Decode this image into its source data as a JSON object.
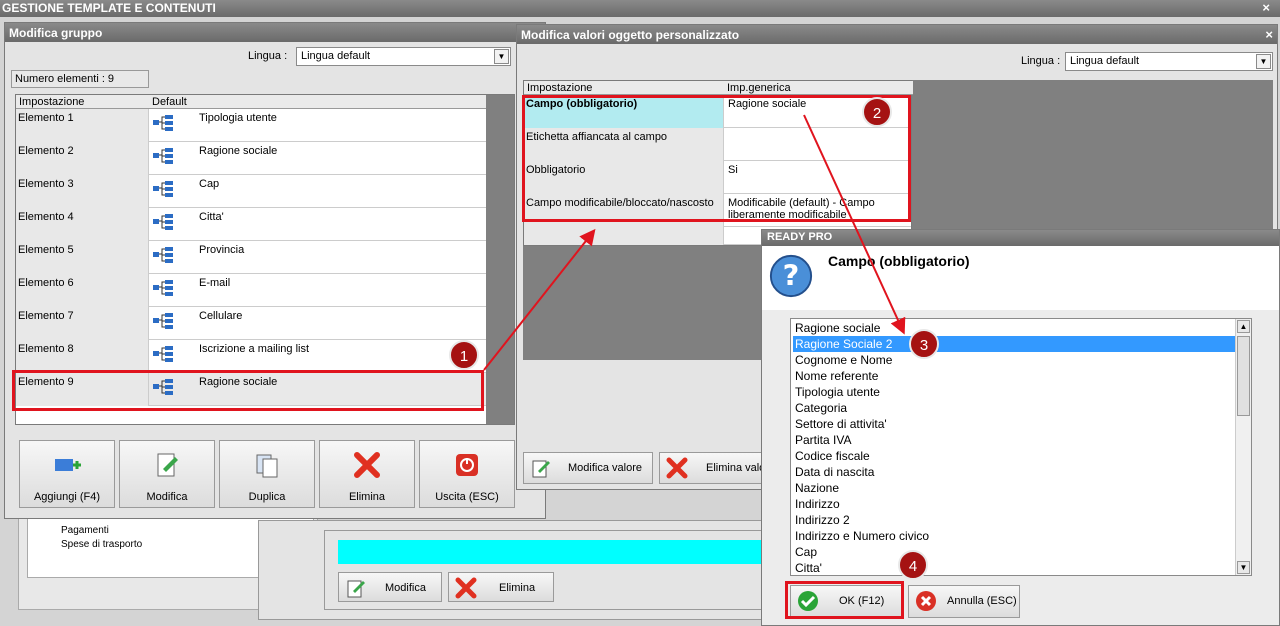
{
  "main_title": "GESTIONE TEMPLATE E CONTENUTI",
  "group_window": {
    "title": "Modifica gruppo",
    "lingua_label": "Lingua :",
    "lingua_value": "Lingua default",
    "count_label": "Numero elementi : 9",
    "columns": [
      "Impostazione",
      "Default"
    ],
    "rows": [
      {
        "name": "Elemento 1",
        "value": "Tipologia utente"
      },
      {
        "name": "Elemento 2",
        "value": "Ragione sociale"
      },
      {
        "name": "Elemento 3",
        "value": "Cap"
      },
      {
        "name": "Elemento 4",
        "value": "Citta'"
      },
      {
        "name": "Elemento 5",
        "value": "Provincia"
      },
      {
        "name": "Elemento 6",
        "value": "E-mail"
      },
      {
        "name": "Elemento 7",
        "value": "Cellulare"
      },
      {
        "name": "Elemento 8",
        "value": "Iscrizione a mailing list"
      },
      {
        "name": "Elemento 9",
        "value": "Ragione sociale"
      }
    ],
    "buttons": [
      "Aggiungi (F4)",
      "Modifica",
      "Duplica",
      "Elimina",
      "Uscita (ESC)"
    ]
  },
  "background": {
    "tree_items": [
      "Pagamenti",
      "Spese di trasporto"
    ],
    "buttons": [
      "Modifica",
      "Elimina"
    ]
  },
  "object_window": {
    "title": "Modifica valori oggetto personalizzato",
    "lingua_label": "Lingua :",
    "lingua_value": "Lingua default",
    "columns": [
      "Impostazione",
      "Imp.generica"
    ],
    "rows": [
      {
        "name": "Campo (obbligatorio)",
        "value": "Ragione sociale"
      },
      {
        "name": "Etichetta affiancata al campo",
        "value": ""
      },
      {
        "name": "Obbligatorio",
        "value": "Si"
      },
      {
        "name": "Campo modificabile/bloccato/nascosto",
        "value": "Modificabile (default) - Campo liberamente modificabile"
      }
    ],
    "buttons": [
      "Modifica valore",
      "Elimina valo"
    ]
  },
  "dialog": {
    "title": "READY PRO",
    "heading": "Campo (obbligatorio)",
    "options": [
      "Ragione sociale",
      "Ragione Sociale 2",
      "Cognome e Nome",
      "Nome referente",
      "Tipologia utente",
      "Categoria",
      "Settore di attivita'",
      "Partita IVA",
      "Codice fiscale",
      "Data di nascita",
      "Nazione",
      "Indirizzo",
      "Indirizzo 2",
      "Indirizzo e Numero civico",
      "Cap",
      "Citta'"
    ],
    "selected_index": 1,
    "ok_label": "OK (F12)",
    "cancel_label": "Annulla (ESC)"
  },
  "annotations": [
    "1",
    "2",
    "3",
    "4"
  ],
  "colors": {
    "highlight": "#3399ff",
    "annotation_red": "#e0141e",
    "badge": "#a51212",
    "cyan": "#00ffff",
    "selected_cell": "#b2ebf0"
  },
  "close_symbol": "×",
  "dropdown_symbol": "▼",
  "scroll_up_symbol": "▲",
  "scroll_down_symbol": "▼"
}
